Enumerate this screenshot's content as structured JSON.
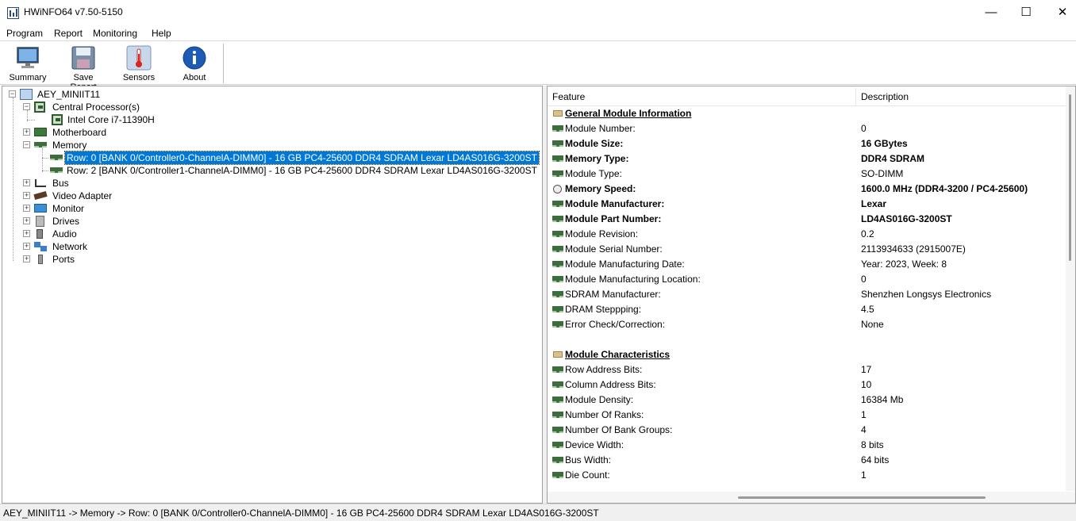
{
  "window": {
    "title": "HWiNFO64 v7.50-5150",
    "minimize_glyph": "—",
    "maximize_glyph": "☐",
    "close_glyph": "✕"
  },
  "menu": {
    "items": [
      "Program",
      "Report",
      "Monitoring",
      "Help"
    ]
  },
  "toolbar": {
    "buttons": [
      {
        "label": "Summary",
        "icon": "monitor-icon"
      },
      {
        "label": "Save Report",
        "icon": "floppy-disk-icon"
      },
      {
        "label": "Sensors",
        "icon": "thermometer-icon"
      },
      {
        "label": "About",
        "icon": "info-icon"
      }
    ]
  },
  "tree": {
    "root": "AEY_MINIIT11",
    "cpu": "Central Processor(s)",
    "cpu_child": "Intel Core i7-11390H",
    "motherboard": "Motherboard",
    "memory": "Memory",
    "mem_row0": "Row: 0 [BANK 0/Controller0-ChannelA-DIMM0] - 16 GB PC4-25600 DDR4 SDRAM Lexar LD4AS016G-3200ST",
    "mem_row2": "Row: 2 [BANK 0/Controller1-ChannelA-DIMM0] - 16 GB PC4-25600 DDR4 SDRAM Lexar LD4AS016G-3200ST",
    "bus": "Bus",
    "video": "Video Adapter",
    "monitor": "Monitor",
    "drives": "Drives",
    "audio": "Audio",
    "network": "Network",
    "ports": "Ports",
    "expand_glyph": "+",
    "collapse_glyph": "−"
  },
  "details": {
    "col_feature": "Feature",
    "col_description": "Description",
    "sec1": "General Module Information",
    "sec2": "Module Characteristics",
    "rows": [
      {
        "feature": "Module Number:",
        "value": "0"
      },
      {
        "feature": "Module Size:",
        "value": "16 GBytes"
      },
      {
        "feature": "Memory Type:",
        "value": "DDR4 SDRAM"
      },
      {
        "feature": "Module Type:",
        "value": "SO-DIMM"
      },
      {
        "feature": "Memory Speed:",
        "value": "1600.0 MHz (DDR4-3200 / PC4-25600)"
      },
      {
        "feature": "Module Manufacturer:",
        "value": "Lexar"
      },
      {
        "feature": "Module Part Number:",
        "value": "LD4AS016G-3200ST"
      },
      {
        "feature": "Module Revision:",
        "value": "0.2"
      },
      {
        "feature": "Module Serial Number:",
        "value": "2113934633 (2915007E)"
      },
      {
        "feature": "Module Manufacturing Date:",
        "value": "Year: 2023, Week: 8"
      },
      {
        "feature": "Module Manufacturing Location:",
        "value": "0"
      },
      {
        "feature": "SDRAM Manufacturer:",
        "value": "Shenzhen Longsys Electronics"
      },
      {
        "feature": "DRAM Steppping:",
        "value": "4.5"
      },
      {
        "feature": "Error Check/Correction:",
        "value": "None"
      }
    ],
    "rows2": [
      {
        "feature": "Row Address Bits:",
        "value": "17"
      },
      {
        "feature": "Column Address Bits:",
        "value": "10"
      },
      {
        "feature": "Module Density:",
        "value": "16384 Mb"
      },
      {
        "feature": "Number Of Ranks:",
        "value": "1"
      },
      {
        "feature": "Number Of Bank Groups:",
        "value": "4"
      },
      {
        "feature": "Device Width:",
        "value": "8 bits"
      },
      {
        "feature": "Bus Width:",
        "value": "64 bits"
      },
      {
        "feature": "Die Count:",
        "value": "1"
      }
    ]
  },
  "status": {
    "path": "AEY_MINIIT11 -> Memory -> Row: 0 [BANK 0/Controller0-ChannelA-DIMM0] - 16 GB PC4-25600 DDR4 SDRAM Lexar LD4AS016G-3200ST"
  }
}
